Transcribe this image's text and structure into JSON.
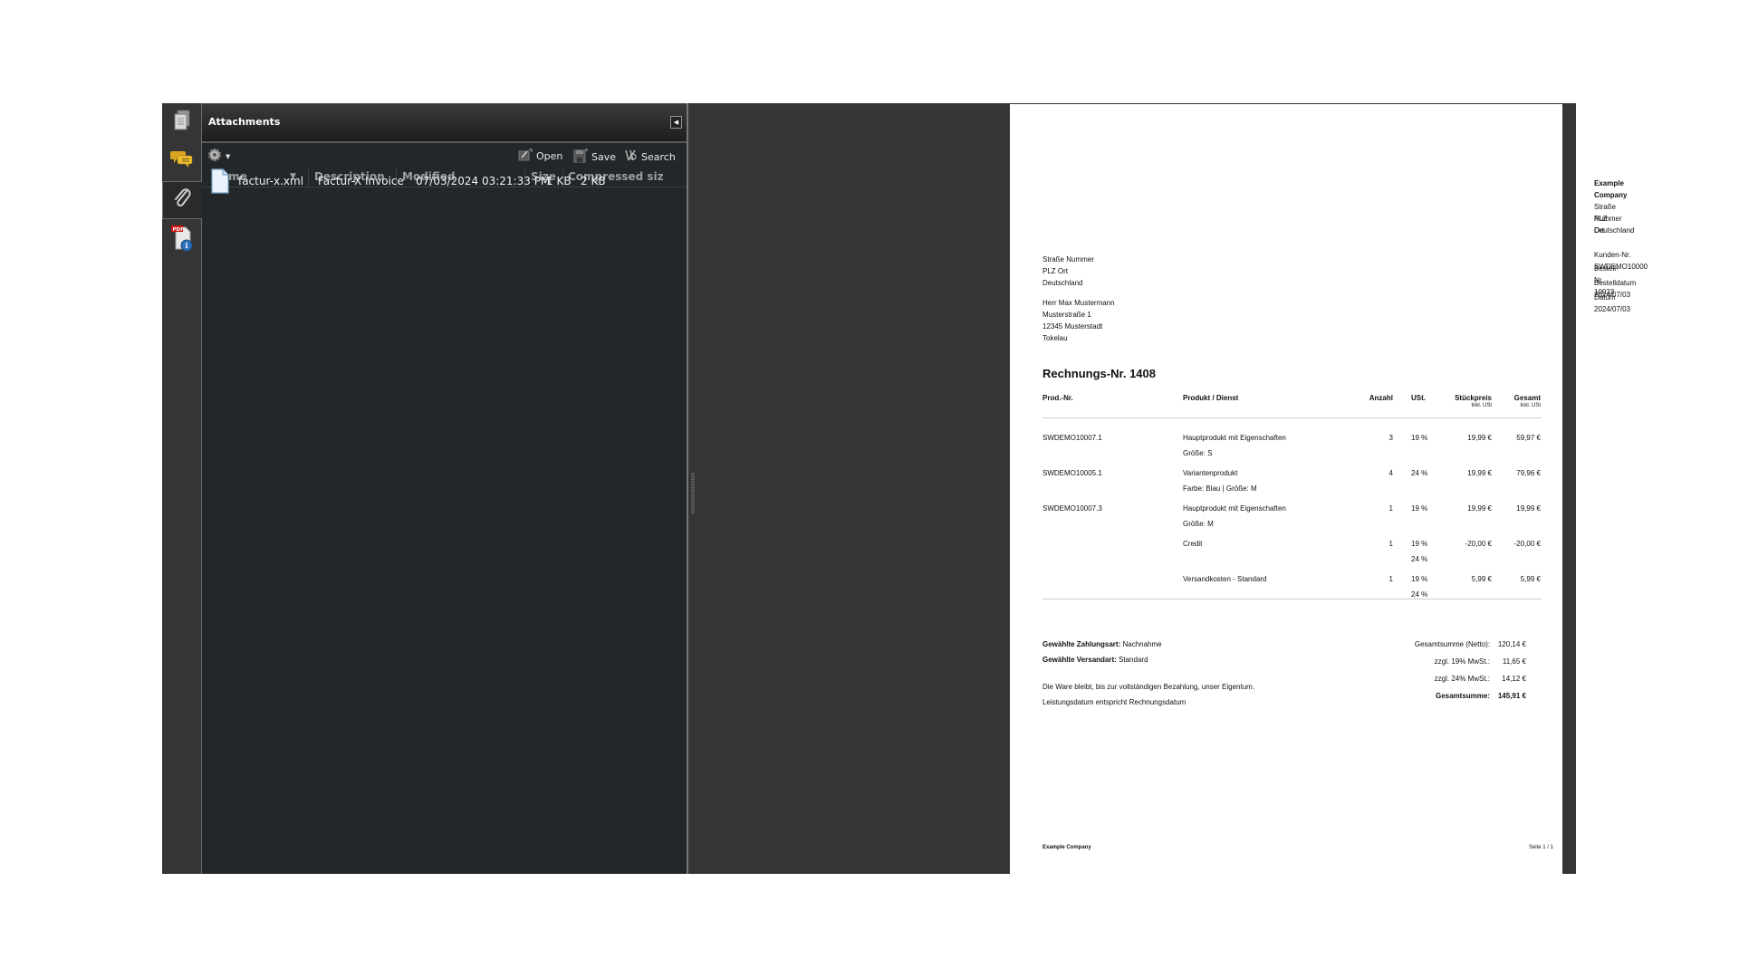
{
  "sidebar_rail": {
    "items": [
      {
        "name": "pages",
        "icon": "pages-icon",
        "active": false
      },
      {
        "name": "comments",
        "icon": "comments-icon",
        "active": false
      },
      {
        "name": "attachments",
        "icon": "paperclip-icon",
        "active": true
      },
      {
        "name": "document-properties",
        "icon": "pdf-info-icon",
        "active": false
      }
    ]
  },
  "attachments_panel": {
    "title": "Attachments",
    "toolbar": {
      "options_icon": "gear-icon",
      "open_label": "Open",
      "save_label": "Save",
      "search_label": "Search"
    },
    "columns": [
      "Name",
      "Description",
      "Modified",
      "Size",
      "Compressed siz"
    ],
    "sort_column": "Name",
    "files": [
      {
        "name": "factur-x.xml",
        "description": "Factur-X Invoice",
        "modified": "07/03/2024 03:21:33 PM",
        "size": "1 KB",
        "compressed_size": "2 KB"
      }
    ]
  },
  "invoice": {
    "sender": {
      "company": "Example Company",
      "street": "Straße Nummer",
      "city": "PLZ Ort",
      "country": "Deutschland"
    },
    "sender_line": {
      "street": "Straße Nummer",
      "city": "PLZ Ort",
      "country": "Deutschland"
    },
    "recipient": {
      "name": "Herr Max Mustermann",
      "street": "Musterstraße 1",
      "city": "12345 Musterstadt",
      "country": "Tokelau"
    },
    "meta": {
      "customer_no": "Kunden-Nr. SWDEMO10000",
      "order_no": "Bestell-Nr. 10023",
      "order_date": "Bestelldatum 2024/07/03",
      "date": "Datum 2024/07/03"
    },
    "title": "Rechnungs-Nr. 1408",
    "table_headers": {
      "prod_no": "Prod.-Nr.",
      "product": "Produkt / Dienst",
      "qty": "Anzahl",
      "tax": "USt.",
      "unit_price": "Stückpreis",
      "unit_price_sub": "Inkl. USt",
      "total": "Gesamt",
      "total_sub": "Inkl. USt"
    },
    "rows": [
      {
        "prod_no": "SWDEMO10007.1",
        "product": "Hauptprodukt mit Eigenschaften",
        "detail": "Größe: S",
        "qty": "3",
        "tax": "19 %",
        "tax2": "",
        "unit_price": "19,99 €",
        "total": "59,97 €"
      },
      {
        "prod_no": "SWDEMO10005.1",
        "product": "Variantenprodukt",
        "detail": "Farbe: Blau | Größe: M",
        "qty": "4",
        "tax": "24 %",
        "tax2": "",
        "unit_price": "19,99 €",
        "total": "79,96 €"
      },
      {
        "prod_no": "SWDEMO10007.3",
        "product": "Hauptprodukt mit Eigenschaften",
        "detail": "Größe: M",
        "qty": "1",
        "tax": "19 %",
        "tax2": "",
        "unit_price": "19,99 €",
        "total": "19,99 €"
      },
      {
        "prod_no": "",
        "product": "Credit",
        "detail": "",
        "qty": "1",
        "tax": "19 %",
        "tax2": "24 %",
        "unit_price": "-20,00 €",
        "total": "-20,00 €"
      },
      {
        "prod_no": "",
        "product": "Versandkosten - Standard",
        "detail": "",
        "qty": "1",
        "tax": "19 %",
        "tax2": "24 %",
        "unit_price": "5,99 €",
        "total": "5,99 €"
      }
    ],
    "payment_label": "Gewählte Zahlungsart:",
    "payment_value": "Nachnahme",
    "shipping_label": "Gewählte Versandart:",
    "shipping_value": "Standard",
    "note1": "Die Ware bleibt, bis zur vollständigen Bezahlung, unser Eigentum.",
    "note2": "Leistungsdatum entspricht Rechnungsdatum",
    "totals": [
      {
        "label": "Gesamtsumme (Netto):",
        "value": "120,14 €",
        "bold": false
      },
      {
        "label": "zzgl. 19% MwSt.:",
        "value": "11,65 €",
        "bold": false
      },
      {
        "label": "zzgl. 24% MwSt.:",
        "value": "14,12 €",
        "bold": false
      },
      {
        "label": "Gesamtsumme:",
        "value": "145,91 €",
        "bold": true
      }
    ],
    "footer_left": "Example Company",
    "footer_right": "Seite 1 / 1"
  }
}
